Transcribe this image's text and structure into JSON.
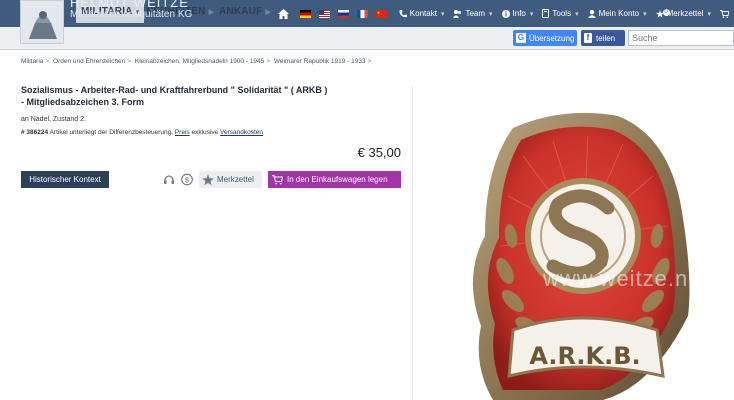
{
  "brand": {
    "name": "HELMUT WEITZE",
    "subtitle": "Militärische Antiquitäten KG"
  },
  "topbar": {
    "items": [
      {
        "label": "Kontakt"
      },
      {
        "label": "Team"
      },
      {
        "label": "Info"
      },
      {
        "label": "Tools"
      },
      {
        "label": "Mein Konto"
      },
      {
        "label": "Merkzettel",
        "badge": "0"
      }
    ]
  },
  "nav": {
    "items": [
      {
        "label": "MILITARIA"
      },
      {
        "label": "NEUHEITEN"
      },
      {
        "label": "ANKAUF"
      }
    ],
    "translate_label": "Übersetzung",
    "share_label": "teilen",
    "search_placeholder": "Suche"
  },
  "breadcrumb": [
    "Militaria",
    "Orden und Ehrenzeichen",
    "Kleinabzeichen, Mitgliedsnadeln 1900 - 1945",
    "Weimarer Republik 1919 - 1933"
  ],
  "product": {
    "title_line1": "Sozialismus - Arbeiter-Rad- und Kraftfahrerbund \" Solidarität \" ( ARKB )",
    "title_line2": "- Mitgliedsabzeichen 3. Form",
    "condition": "an Nadel, Zustand 2.",
    "article_number": "# 386224",
    "article_text": "Artikel unterliegt der Differenzbesteuerung,",
    "price_link": "Preis",
    "shipping_prefix": "exklusive",
    "shipping_link": "Versandkosten",
    "price": "€ 35,00"
  },
  "buttons": {
    "historical": "Historischer Kontext",
    "wishlist": "Merkzettel",
    "add_to_cart": "In den Einkaufswagen legen"
  },
  "image": {
    "badge_letters": "A.R.K.B.",
    "watermark": "www.weitze.net"
  },
  "colors": {
    "topbar": "#3f5c7e",
    "nav_bg": "#eceff2",
    "hist_button": "#2a3f58",
    "cart_button": "#a233a8",
    "enamel_red": "#c8322a"
  }
}
